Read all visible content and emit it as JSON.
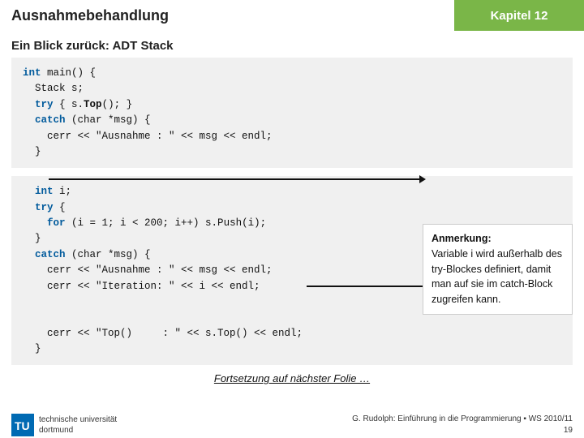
{
  "header": {
    "title": "Ausnahmebehandlung",
    "chapter": "Kapitel 12"
  },
  "subtitle": "Ein Blick zurück: ADT Stack",
  "code_block1": {
    "lines": [
      "int main() {",
      "  Stack s;",
      "  try { s.Top(); }",
      "  catch (char *msg) {",
      "    cerr << \"Ausnahme : \" << msg << endl;",
      "  }"
    ]
  },
  "code_block2": {
    "lines": [
      "  int i;",
      "  try {",
      "    for (i = 1; i < 200; i++) s.Push(i);",
      "  }",
      "  catch (char *msg) {",
      "    cerr << \"Ausnahme : \" << msg << endl;",
      "    cerr << \"Iteration: \" << i << endl;",
      "    cerr << \"Top()     : \" << s.Top() << endl;",
      "  }"
    ]
  },
  "note": {
    "title": "Anmerkung:",
    "text": "Variable i wird außerhalb des try-Blockes definiert, damit man auf sie im catch-Block zugreifen kann."
  },
  "footer": {
    "continuation": "Fortsetzung auf nächster Folie …",
    "credit": "G. Rudolph: Einführung in die Programmierung ▪ WS 2010/11",
    "page": "19"
  },
  "tud": {
    "line1": "technische universität",
    "line2": "dortmund"
  }
}
